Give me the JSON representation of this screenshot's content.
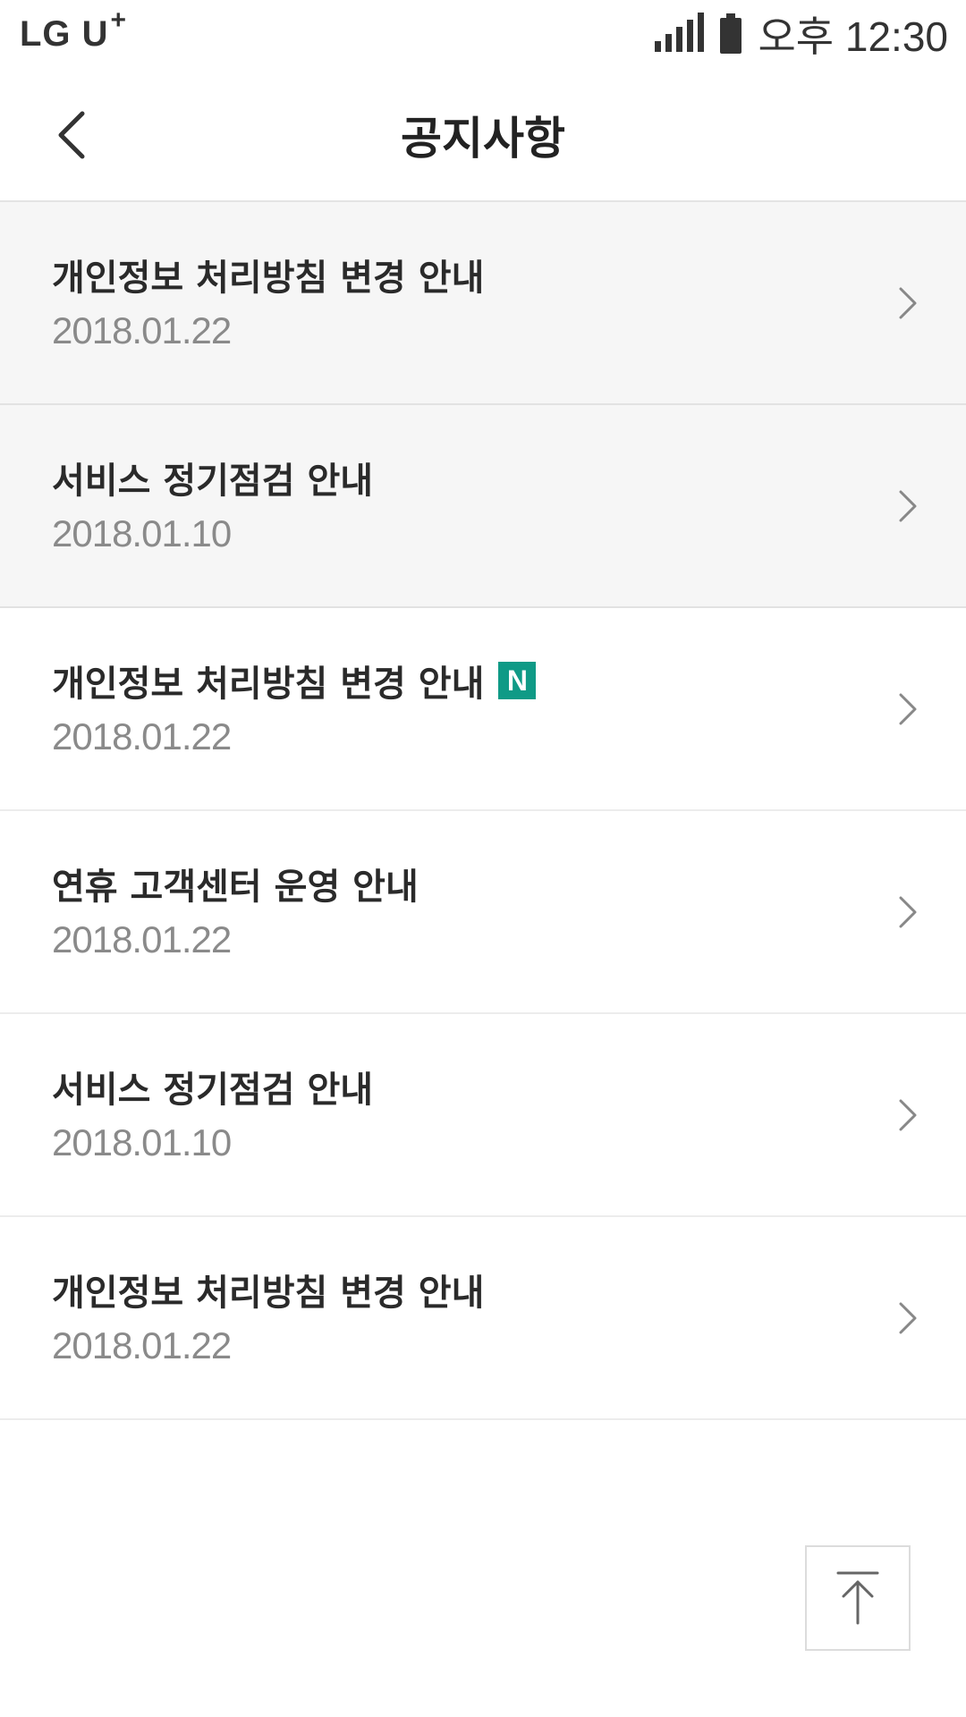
{
  "status_bar": {
    "carrier": "LG U",
    "carrier_plus": "+",
    "time": "오후 12:30",
    "icons": [
      "signal-icon",
      "battery-icon"
    ]
  },
  "header": {
    "title": "공지사항",
    "back_icon": "chevron-left-icon"
  },
  "notices": [
    {
      "title": "개인정보 처리방침 변경 안내",
      "date": "2018.01.22",
      "read": true,
      "new": false
    },
    {
      "title": "서비스 정기점검 안내",
      "date": "2018.01.10",
      "read": true,
      "new": false
    },
    {
      "title": "개인정보 처리방침 변경 안내",
      "date": "2018.01.22",
      "read": false,
      "new": true,
      "badge": "N"
    },
    {
      "title": "연휴 고객센터 운영 안내",
      "date": "2018.01.22",
      "read": false,
      "new": false
    },
    {
      "title": "서비스 정기점검 안내",
      "date": "2018.01.10",
      "read": false,
      "new": false
    },
    {
      "title": "개인정보 처리방침 변경 안내",
      "date": "2018.01.22",
      "read": false,
      "new": false
    }
  ],
  "scroll_top": {
    "icon": "arrow-up-to-top-icon"
  },
  "colors": {
    "read_background": "#f6f6f6",
    "new_badge": "#0f9a86",
    "date_text": "#8a8a8a"
  }
}
